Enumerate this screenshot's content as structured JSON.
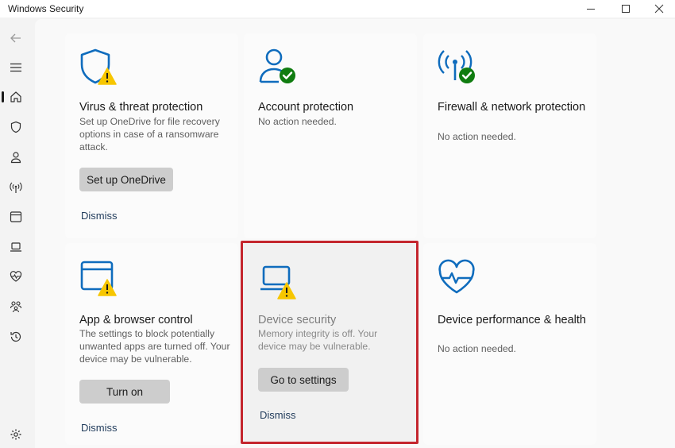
{
  "window": {
    "title": "Windows Security",
    "controls": {
      "minimize": "minimize",
      "maximize": "maximize",
      "close": "close"
    }
  },
  "rail": {
    "items": [
      {
        "icon": "back-arrow-icon"
      },
      {
        "icon": "hamburger-menu-icon"
      },
      {
        "icon": "home-icon",
        "active": true
      },
      {
        "icon": "shield-icon"
      },
      {
        "icon": "person-icon"
      },
      {
        "icon": "wireless-signal-icon"
      },
      {
        "icon": "app-window-icon"
      },
      {
        "icon": "laptop-icon"
      },
      {
        "icon": "heart-pulse-icon"
      },
      {
        "icon": "family-icon"
      },
      {
        "icon": "history-icon"
      },
      {
        "icon": "settings-gear-icon"
      }
    ]
  },
  "cards": {
    "virus": {
      "title": "Virus & threat protection",
      "desc": "Set up OneDrive for file recovery options in case of a ransomware attack.",
      "button": "Set up OneDrive",
      "dismiss": "Dismiss",
      "status": "warning"
    },
    "account": {
      "title": "Account protection",
      "desc": "No action needed.",
      "status": "ok"
    },
    "firewall": {
      "title": "Firewall & network protection",
      "desc": "No action needed.",
      "status": "ok"
    },
    "appbrowser": {
      "title": "App & browser control",
      "desc": "The settings to block potentially unwanted apps are turned off. Your device may be vulnerable.",
      "button": "Turn on",
      "dismiss": "Dismiss",
      "status": "warning"
    },
    "device_security": {
      "title": "Device security",
      "desc": "Memory integrity is off. Your device may be vulnerable.",
      "button": "Go to settings",
      "dismiss": "Dismiss",
      "status": "warning",
      "highlighted": true
    },
    "performance": {
      "title": "Device performance & health",
      "desc": "No action needed.",
      "status": "ok"
    }
  },
  "colors": {
    "icon_blue": "#0f6cbd",
    "ok_green": "#107c10",
    "warning_yellow": "#f7c600",
    "highlight_red": "#c4262e"
  }
}
